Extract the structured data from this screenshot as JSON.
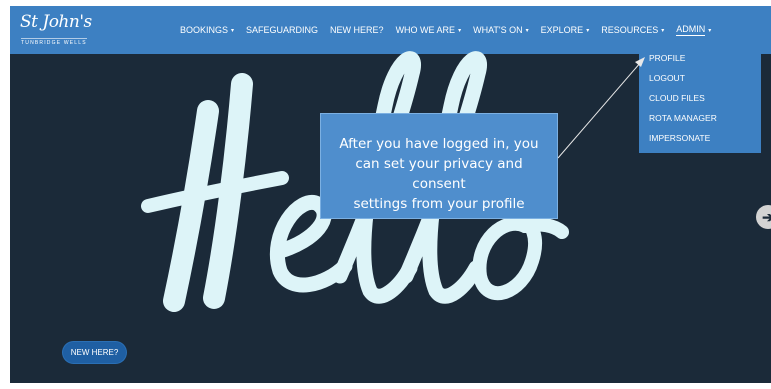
{
  "logo": {
    "script": "St John's",
    "subtitle": "TUNBRIDGE WELLS"
  },
  "nav": {
    "items": [
      {
        "label": "BOOKINGS",
        "caret": "▾"
      },
      {
        "label": "SAFEGUARDING",
        "caret": ""
      },
      {
        "label": "NEW HERE?",
        "caret": ""
      },
      {
        "label": "WHO WE ARE",
        "caret": "▾"
      },
      {
        "label": "WHAT'S ON",
        "caret": "▾"
      },
      {
        "label": "EXPLORE",
        "caret": "▾"
      },
      {
        "label": "RESOURCES",
        "caret": "▾"
      },
      {
        "label": "ADMIN",
        "caret": "▾"
      }
    ]
  },
  "admin_dropdown": {
    "items": [
      {
        "label": "PROFILE"
      },
      {
        "label": "LOGOUT"
      },
      {
        "label": "CLOUD FILES"
      },
      {
        "label": "ROTA MANAGER"
      },
      {
        "label": "IMPERSONATE"
      }
    ]
  },
  "hero": {
    "text": "Hello"
  },
  "callout": {
    "line1": "After you have logged in, you",
    "line2": "can set your privacy and consent",
    "line3": "settings from your profile"
  },
  "new_here_button": {
    "label": "NEW HERE?"
  },
  "colors": {
    "navbar": "#3d80c2",
    "hero_bg": "#1b2a39",
    "hero_text": "#ddf4f8",
    "callout_bg": "#4f8ecd",
    "button_bg": "#1f5fa3"
  },
  "icons": {
    "side_arrow": "arrow-right-circle-icon",
    "caret": "caret-down-icon"
  }
}
